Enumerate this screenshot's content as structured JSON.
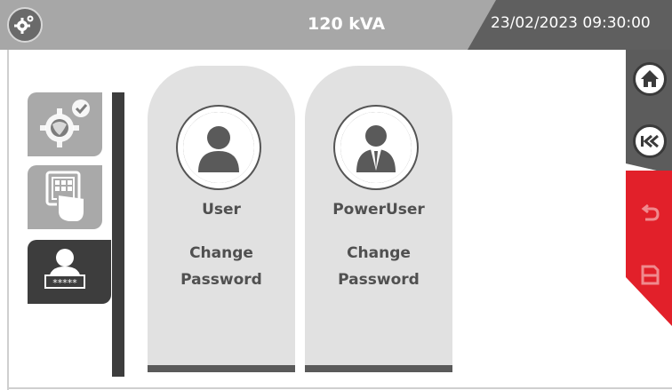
{
  "header": {
    "power": "120 kVA",
    "datetime": "23/02/2023 09:30:00",
    "logo_icon": "gears-icon"
  },
  "sidebar": {
    "tabs": [
      {
        "icon": "settings-globe-icon",
        "active": false
      },
      {
        "icon": "keypad-hand-icon",
        "active": false
      },
      {
        "icon": "user-password-icon",
        "active": true,
        "password_mask": "*****"
      }
    ]
  },
  "cards": [
    {
      "title": "User",
      "action_line1": "Change",
      "action_line2": "Password",
      "icon": "user-icon"
    },
    {
      "title": "PowerUser",
      "action_line1": "Change",
      "action_line2": "Password",
      "icon": "power-user-icon"
    }
  ],
  "right_rail": {
    "buttons": [
      {
        "icon": "home-icon"
      },
      {
        "icon": "back-icon"
      },
      {
        "icon": "undo-icon"
      },
      {
        "icon": "save-icon"
      }
    ]
  },
  "colors": {
    "header_bg": "#a7a7a7",
    "header_dark": "#5f5f5f",
    "accent_red": "#e2202a",
    "card_bg": "#e1e1e1",
    "tab_active": "#3d3d3d"
  }
}
